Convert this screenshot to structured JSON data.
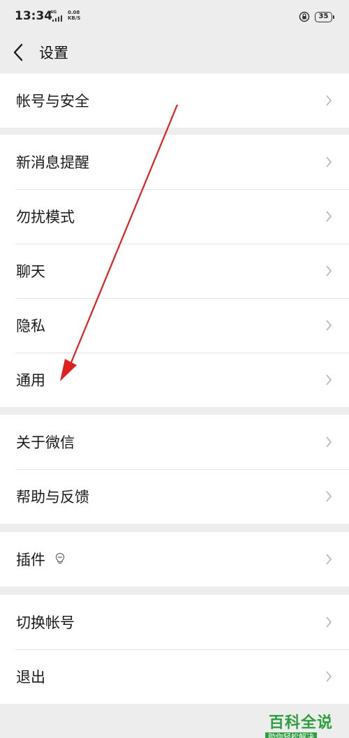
{
  "status_bar": {
    "time": "13:34",
    "network": "4G",
    "speed_value": "0.08",
    "speed_unit": "KB/S",
    "battery": "35"
  },
  "header": {
    "back_icon": "chevron-left-icon",
    "title": "设置"
  },
  "groups": [
    {
      "items": [
        {
          "label": "帐号与安全"
        }
      ]
    },
    {
      "items": [
        {
          "label": "新消息提醒"
        },
        {
          "label": "勿扰模式"
        },
        {
          "label": "聊天"
        },
        {
          "label": "隐私"
        },
        {
          "label": "通用"
        }
      ]
    },
    {
      "items": [
        {
          "label": "关于微信"
        },
        {
          "label": "帮助与反馈"
        }
      ]
    },
    {
      "items": [
        {
          "label": "插件",
          "icon": "lightbulb-icon"
        }
      ]
    },
    {
      "items": [
        {
          "label": "切换帐号"
        },
        {
          "label": "退出"
        }
      ]
    }
  ],
  "chevron_icon": "chevron-right-icon",
  "annotation": {
    "icon": "red-arrow-icon",
    "color": "#e02020"
  },
  "watermark": {
    "title": "百科全说",
    "subtitle": "助你轻松解决"
  },
  "colors": {
    "background": "#ededed",
    "card": "#ffffff",
    "divider": "#e5e5e5",
    "chevron": "#b2b2b2",
    "watermark_green": "#2e9f3e"
  }
}
